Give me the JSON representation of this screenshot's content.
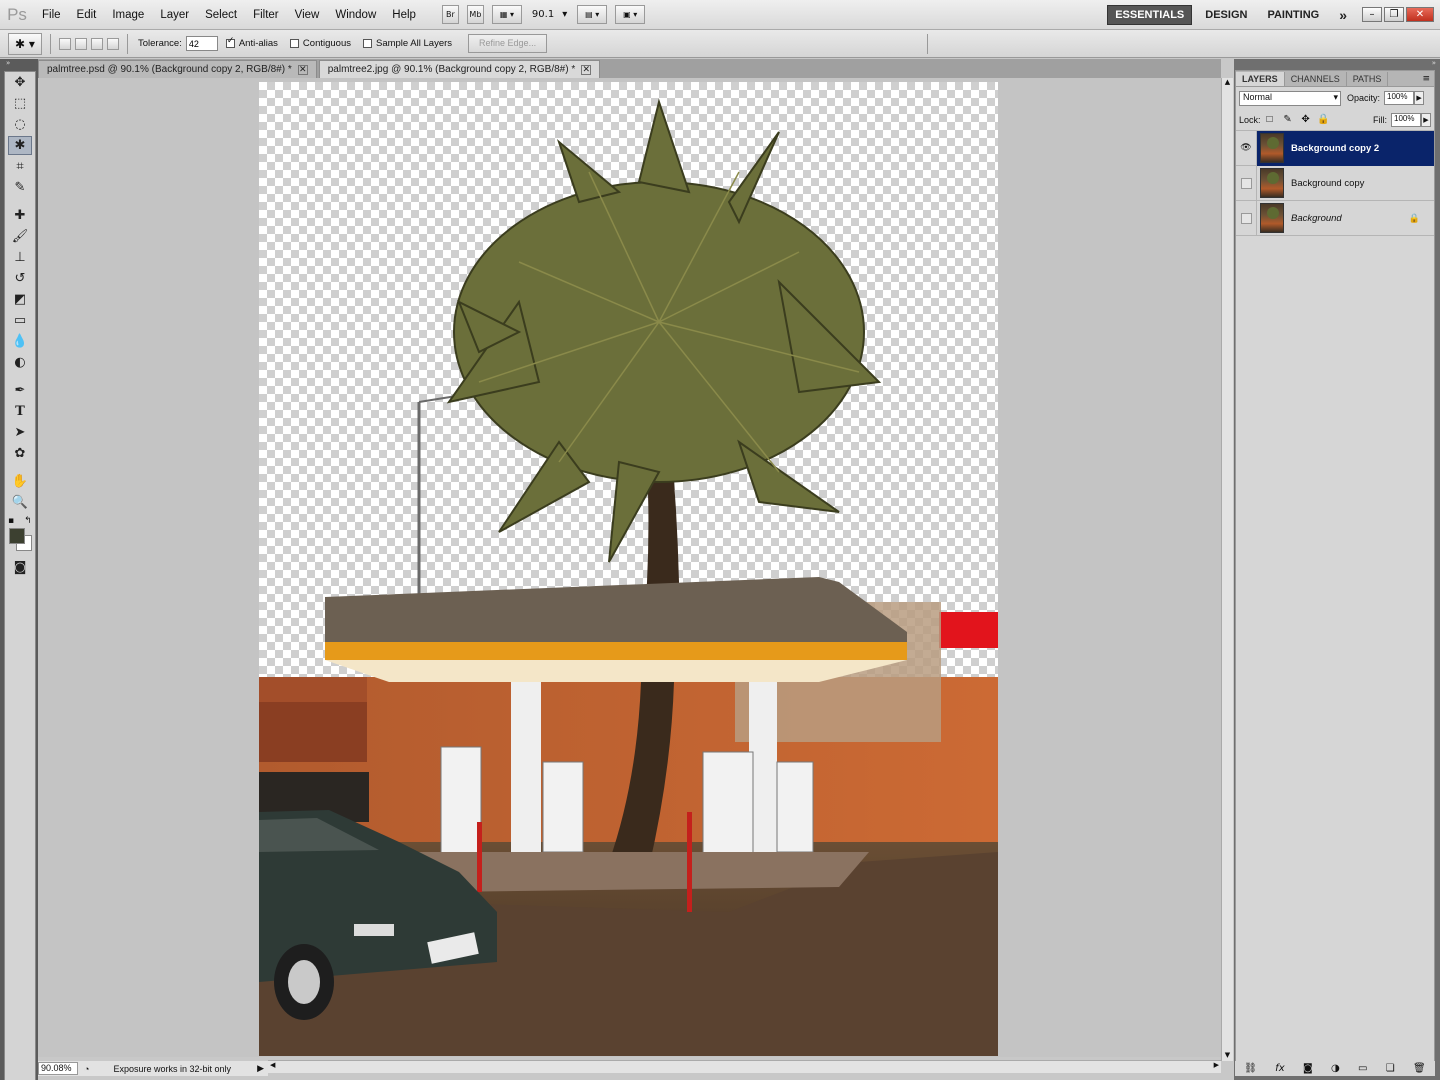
{
  "app": {
    "logo": "Ps"
  },
  "menu": [
    "File",
    "Edit",
    "Image",
    "Layer",
    "Select",
    "Filter",
    "View",
    "Window",
    "Help"
  ],
  "menubar": {
    "bridge_label": "Br",
    "minibridge_label": "Mb",
    "zoom_value": "90.1"
  },
  "workspaces": {
    "essentials": "ESSENTIALS",
    "design": "DESIGN",
    "painting": "PAINTING",
    "more": "»"
  },
  "options": {
    "tolerance_label": "Tolerance:",
    "tolerance_value": "42",
    "antialias_label": "Anti-alias",
    "contiguous_label": "Contiguous",
    "sample_all_label": "Sample All Layers",
    "refine_edge_label": "Refine Edge..."
  },
  "tabs": [
    {
      "label": "palmtree.psd @ 90.1% (Background copy 2, RGB/8#) *"
    },
    {
      "label": "palmtree2.jpg @ 90.1% (Background copy 2, RGB/8#) *"
    }
  ],
  "status": {
    "zoom": "90.08%",
    "message": "Exposure works in 32-bit only"
  },
  "layers_panel": {
    "tabs": [
      "LAYERS",
      "CHANNELS",
      "PATHS"
    ],
    "blend_mode": "Normal",
    "opacity_label": "Opacity:",
    "opacity_value": "100%",
    "lock_label": "Lock:",
    "fill_label": "Fill:",
    "fill_value": "100%",
    "layers": [
      {
        "name": "Background copy 2"
      },
      {
        "name": "Background copy"
      },
      {
        "name": "Background"
      }
    ]
  },
  "colors": {
    "selected_layer": "#0a246a",
    "foreground_swatch": "#3c4030",
    "background_swatch": "#ffffff"
  }
}
